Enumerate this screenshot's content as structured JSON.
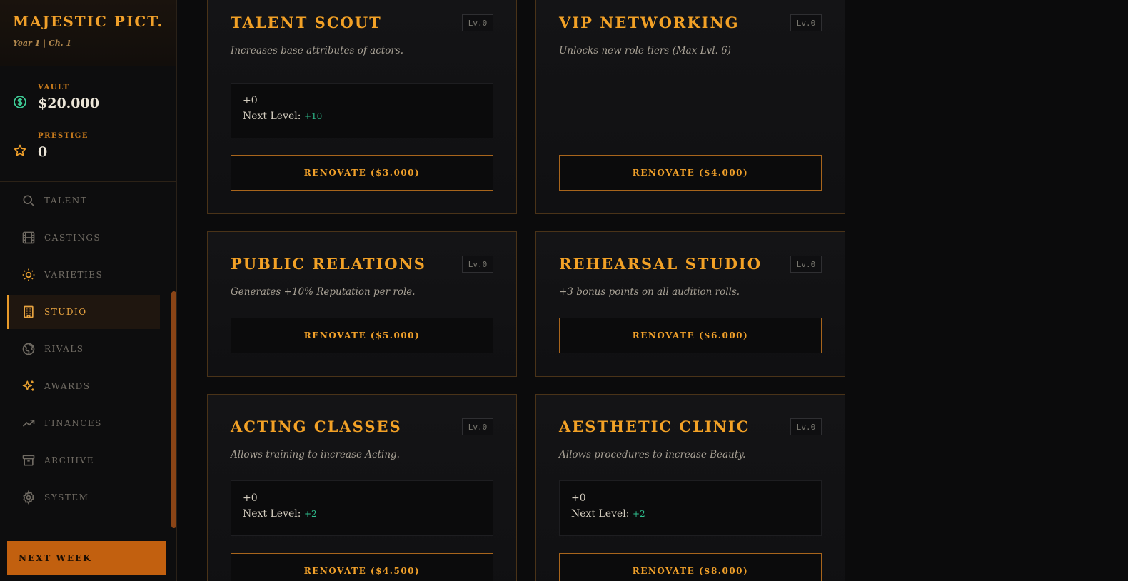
{
  "brand": {
    "title": "MAJESTIC PICT...",
    "subtitle": "Year 1 | Ch. 1"
  },
  "stats": [
    {
      "label": "VAULT",
      "value": "$20.000",
      "icon": "dollar-icon"
    },
    {
      "label": "PRESTIGE",
      "value": "0",
      "icon": "star-icon"
    }
  ],
  "nav": [
    {
      "label": "TALENT",
      "icon": "search-icon"
    },
    {
      "label": "CASTINGS",
      "icon": "film-icon"
    },
    {
      "label": "VARIETIES",
      "icon": "sun-icon"
    },
    {
      "label": "STUDIO",
      "icon": "building-icon",
      "active": true
    },
    {
      "label": "RIVALS",
      "icon": "globe-icon"
    },
    {
      "label": "AWARDS",
      "icon": "sparkles-icon"
    },
    {
      "label": "FINANCES",
      "icon": "trending-up-icon"
    },
    {
      "label": "ARCHIVE",
      "icon": "archive-icon"
    },
    {
      "label": "SYSTEM",
      "icon": "gear-icon"
    }
  ],
  "next_week": "NEXT WEEK",
  "colors": {
    "accent": "#f0a02a",
    "positive": "#2fbf8e",
    "button": "#c2600f"
  },
  "cards": [
    {
      "title": "TALENT SCOUT",
      "level": "Lv.0",
      "desc": "Increases base attributes of actors.",
      "current": "+0",
      "next_label": "Next Level:",
      "next_value": "+10",
      "button": "RENOVATE ($3.000)"
    },
    {
      "title": "VIP NETWORKING",
      "level": "Lv.0",
      "desc": "Unlocks new role tiers (Max Lvl. 6)",
      "button": "RENOVATE ($4.000)"
    },
    {
      "title": "PUBLIC RELATIONS",
      "level": "Lv.0",
      "desc": "Generates +10% Reputation per role.",
      "button": "RENOVATE ($5.000)"
    },
    {
      "title": "REHEARSAL STUDIO",
      "level": "Lv.0",
      "desc": "+3 bonus points on all audition rolls.",
      "button": "RENOVATE ($6.000)"
    },
    {
      "title": "ACTING CLASSES",
      "level": "Lv.0",
      "desc": "Allows training to increase Acting.",
      "current": "+0",
      "next_label": "Next Level:",
      "next_value": "+2",
      "button": "RENOVATE ($4.500)"
    },
    {
      "title": "AESTHETIC CLINIC",
      "level": "Lv.0",
      "desc": "Allows procedures to increase Beauty.",
      "current": "+0",
      "next_label": "Next Level:",
      "next_value": "+2",
      "button": "RENOVATE ($8.000)"
    }
  ]
}
